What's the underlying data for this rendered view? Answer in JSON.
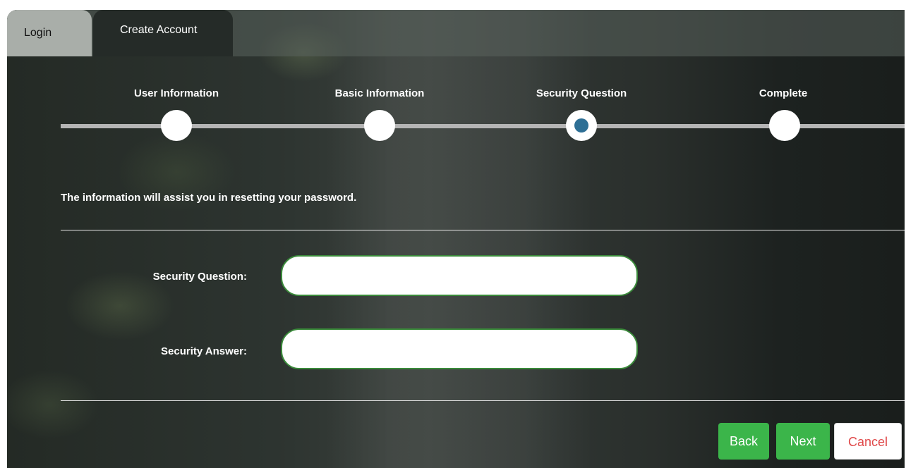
{
  "tabs": {
    "login": "Login",
    "create_account": "Create Account"
  },
  "steps": [
    {
      "label": "User Information",
      "active": false
    },
    {
      "label": "Basic Information",
      "active": false
    },
    {
      "label": "Security Question",
      "active": true
    },
    {
      "label": "Complete",
      "active": false
    }
  ],
  "info_text": "The information will assist you in resetting your password.",
  "form": {
    "security_question_label": "Security Question:",
    "security_question_value": "",
    "security_answer_label": "Security Answer:",
    "security_answer_value": ""
  },
  "buttons": {
    "back": "Back",
    "next": "Next",
    "cancel": "Cancel"
  },
  "colors": {
    "accent_green": "#3bb54a",
    "active_step": "#2e6f95",
    "cancel_text": "#e0494a"
  }
}
